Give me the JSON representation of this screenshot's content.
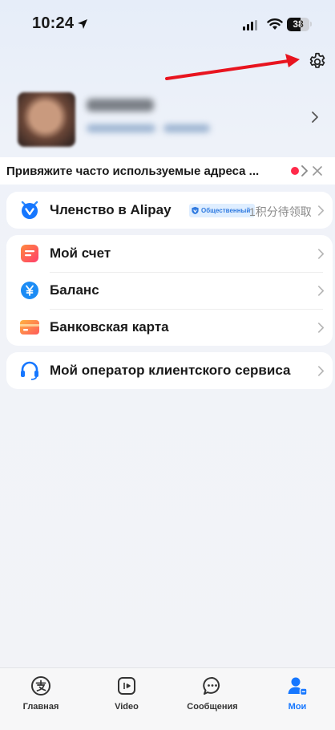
{
  "status_bar": {
    "time": "10:24",
    "battery": "38"
  },
  "profile": {},
  "notice": {
    "text": "Привяжите часто используемые адреса ..."
  },
  "membership": {
    "label": "Членство в Alipay",
    "badge": "Общественный",
    "right_text": "1积分待领取"
  },
  "menu": [
    {
      "label": "Мой счет"
    },
    {
      "label": "Баланс"
    },
    {
      "label": "Банковская карта"
    }
  ],
  "support": {
    "label": "Мой оператор клиентского сервиса"
  },
  "tabbar": [
    {
      "label": "Главная",
      "icon": "alipay-icon"
    },
    {
      "label": "Video",
      "icon": "video-icon"
    },
    {
      "label": "Сообщения",
      "icon": "chat-icon"
    },
    {
      "label": "Мои",
      "icon": "user-icon",
      "active": true
    }
  ],
  "colors": {
    "accent": "#1677ff",
    "annotation": "#e8141f",
    "notice_dot": "#ff2a4a"
  }
}
